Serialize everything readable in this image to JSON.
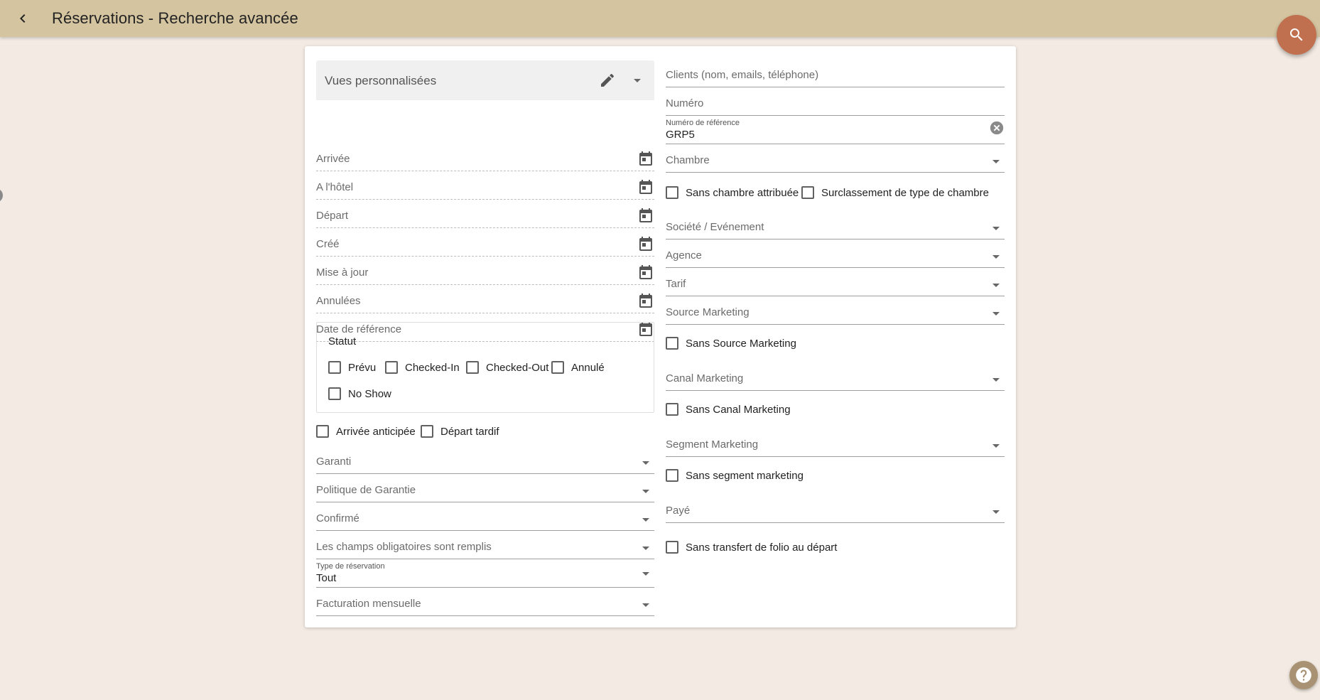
{
  "header": {
    "title": "Réservations - Recherche avancée"
  },
  "views": {
    "label": "Vues personnalisées"
  },
  "date_fields": [
    {
      "label": "Arrivée"
    },
    {
      "label": "A l'hôtel"
    },
    {
      "label": "Départ"
    },
    {
      "label": "Créé"
    },
    {
      "label": "Mise à jour"
    },
    {
      "label": "Annulées"
    },
    {
      "label": "Date de référence"
    }
  ],
  "statut": {
    "title": "Statut",
    "options": [
      "Prévu",
      "Checked-In",
      "Checked-Out",
      "Annulé",
      "No Show"
    ]
  },
  "left_checks": {
    "early_arrival": "Arrivée anticipée",
    "late_departure": "Départ tardif"
  },
  "left_selects": {
    "garanti": "Garanti",
    "politique": "Politique de Garantie",
    "confirme": "Confirmé",
    "champs": "Les champs obligatoires sont remplis",
    "type_label": "Type de réservation",
    "type_value": "Tout",
    "facturation": "Facturation mensuelle"
  },
  "right": {
    "clients": "Clients (nom, emails, téléphone)",
    "numero": "Numéro",
    "ref_label": "Numéro de référence",
    "ref_value": "GRP5",
    "chambre": "Chambre",
    "sans_chambre": "Sans chambre attribuée",
    "surclassement": "Surclassement de type de chambre",
    "societe": "Société / Evénement",
    "agence": "Agence",
    "tarif": "Tarif",
    "source": "Source Marketing",
    "sans_source": "Sans Source Marketing",
    "canal": "Canal Marketing",
    "sans_canal": "Sans Canal Marketing",
    "segment": "Segment Marketing",
    "sans_segment": "Sans segment marketing",
    "paye": "Payé",
    "sans_folio": "Sans transfert de folio au départ"
  },
  "colors": {
    "header_bg": "#d4c4a0",
    "page_bg": "#f3ebe3",
    "fab": "#c0704f",
    "help": "#a89273"
  },
  "icons": {
    "back": "chevron-left-icon",
    "search": "search-icon",
    "help": "help-icon",
    "edit": "pencil-icon",
    "calendar": "calendar-icon",
    "dropdown": "caret-down-icon",
    "clear": "clear-icon"
  }
}
